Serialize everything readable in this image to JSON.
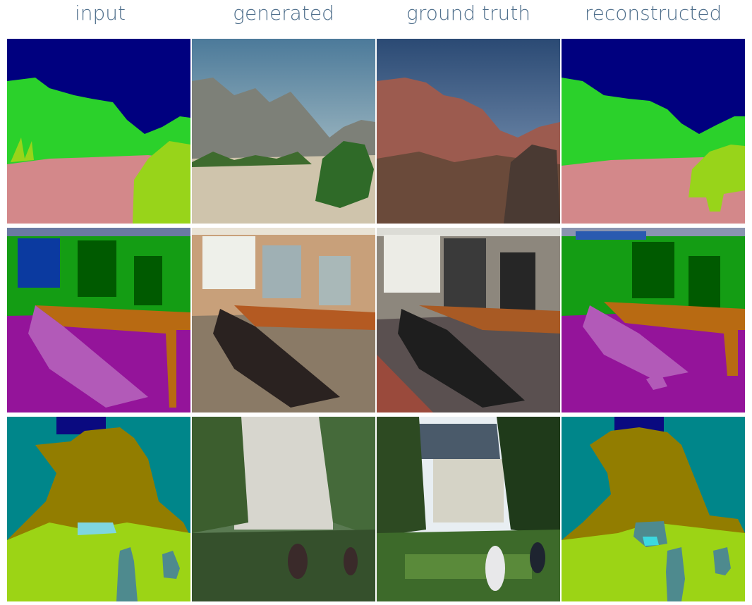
{
  "columns": {
    "input": "input",
    "generated": "generated",
    "ground_truth": "ground truth",
    "reconstructed": "reconstructed"
  },
  "rows": [
    {
      "scene": "desert-mountain-landscape"
    },
    {
      "scene": "conference-room"
    },
    {
      "scene": "formal-garden-with-building"
    }
  ],
  "colors": {
    "seg_sky": "#00007f",
    "seg_tree_green": "#2bd12b",
    "seg_plant_lime": "#98d41a",
    "seg_ground_pink": "#d3888a",
    "seg_wall_green": "#149d14",
    "seg_dark_green": "#005a00",
    "seg_floor_purple": "#94149a",
    "seg_chair_violet": "#b25ab8",
    "seg_table_brown": "#b86a12",
    "seg_building_olive": "#927d00",
    "seg_teal": "#00868a",
    "seg_grass": "#9cd415",
    "seg_person": "#4e8a8e"
  }
}
